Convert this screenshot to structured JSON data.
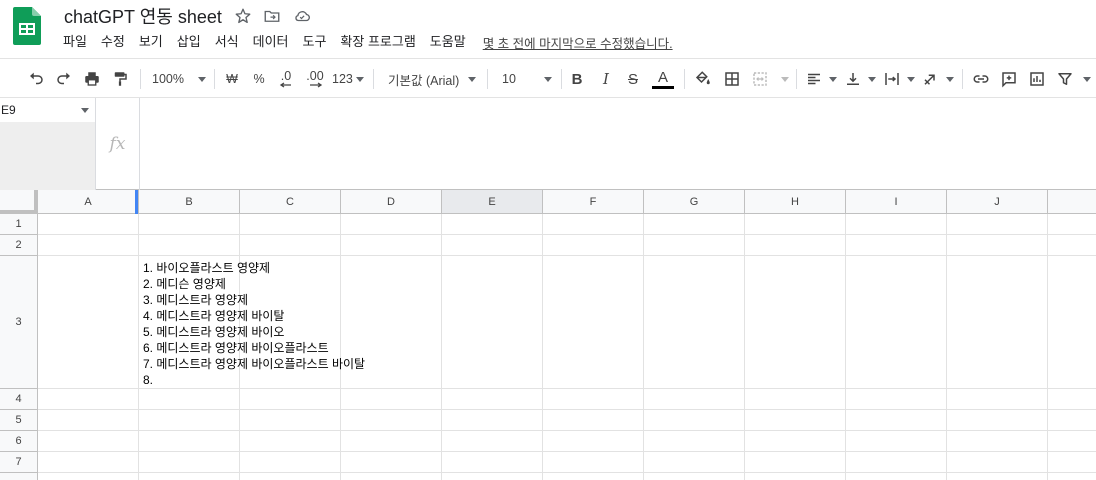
{
  "header": {
    "title": "chatGPT 연동 sheet",
    "menu": [
      "파일",
      "수정",
      "보기",
      "삽입",
      "서식",
      "데이터",
      "도구",
      "확장 프로그램",
      "도움말"
    ],
    "last_edit": "몇 초 전에 마지막으로 수정했습니다."
  },
  "toolbar": {
    "zoom": "100%",
    "currency": "₩",
    "percent": "%",
    "decrease_decimal": ".0",
    "increase_decimal": ".00",
    "number_format": "123",
    "font": "기본값 (Arial)",
    "font_size": "10",
    "bold": "B",
    "italic": "I",
    "strikethrough": "S",
    "text_color": "A"
  },
  "name_box": "E9",
  "fx_label": "fx",
  "columns": [
    "A",
    "B",
    "C",
    "D",
    "E",
    "F",
    "G",
    "H",
    "I",
    "J"
  ],
  "rows": [
    "1",
    "2",
    "3",
    "4",
    "5",
    "6",
    "7"
  ],
  "selected_column": "E",
  "cell_b3": "1. 바이오플라스트 영양제\n2. 메디슨 영양제\n3. 메디스트라 영양제\n4. 메디스트라 영양제 바이탈\n5. 메디스트라 영양제 바이오\n6. 메디스트라 영양제 바이오플라스트\n7. 메디스트라 영양제 바이오플라스트 바이탈\n8.",
  "colors": {
    "logo_green": "#0f9d58",
    "selection_blue": "#4285f4",
    "header_bg": "#f8f9fa"
  }
}
